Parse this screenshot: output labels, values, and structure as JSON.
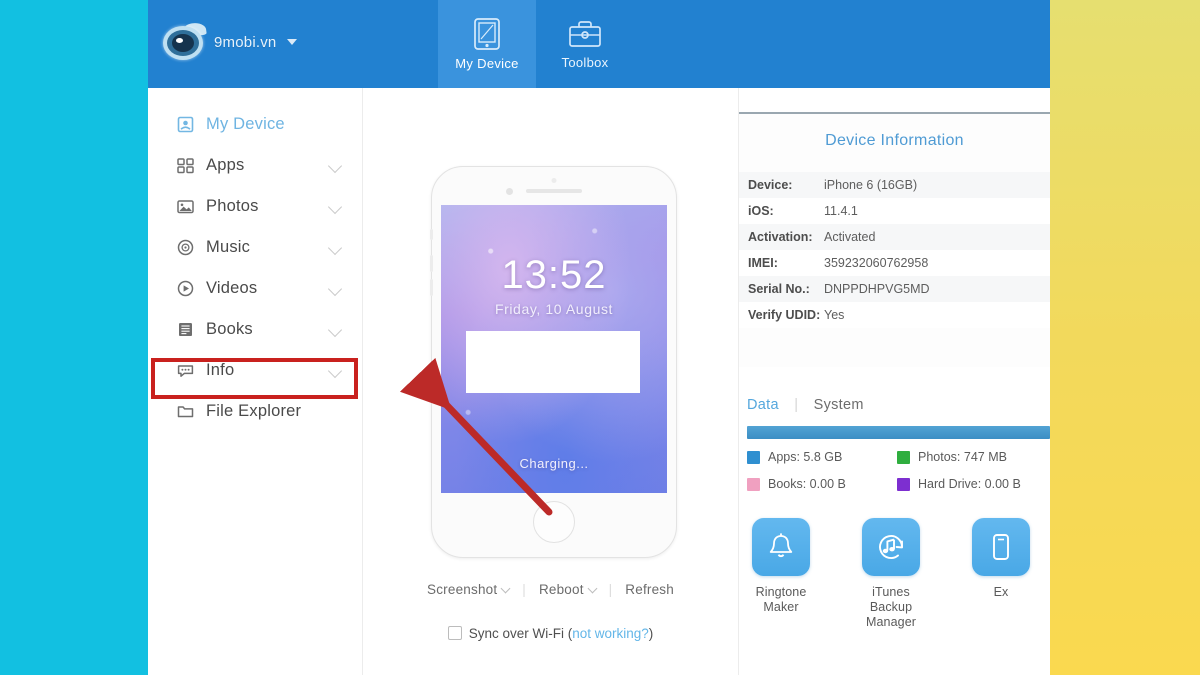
{
  "window": {
    "brand_name": "9mobi.vn",
    "logo_icon": "eye-logo-icon",
    "brand_caret_icon": "caret-down-icon"
  },
  "topbar": {
    "tabs": [
      {
        "label": "My Device",
        "icon": "tablet-icon",
        "active": true
      },
      {
        "label": "Toolbox",
        "icon": "toolbox-icon",
        "active": false
      }
    ]
  },
  "sidebar": {
    "items": [
      {
        "label": "My Device",
        "icon": "device-icon",
        "active": true,
        "expandable": false
      },
      {
        "label": "Apps",
        "icon": "grid-apps-icon",
        "active": false,
        "expandable": true
      },
      {
        "label": "Photos",
        "icon": "photo-icon",
        "active": false,
        "expandable": true
      },
      {
        "label": "Music",
        "icon": "music-disc-icon",
        "active": false,
        "expandable": true
      },
      {
        "label": "Videos",
        "icon": "video-play-icon",
        "active": false,
        "expandable": true
      },
      {
        "label": "Books",
        "icon": "books-icon",
        "active": false,
        "expandable": true
      },
      {
        "label": "Info",
        "icon": "chat-info-icon",
        "active": false,
        "expandable": true
      },
      {
        "label": "File Explorer",
        "icon": "folder-icon",
        "active": false,
        "expandable": false
      }
    ]
  },
  "annotation": {
    "highlight_color": "#c9211e",
    "highlight_target": "Info",
    "arrow_color": "#bc2a28"
  },
  "phone": {
    "lock_time": "13:52",
    "lock_date": "Friday, 10 August",
    "status": "Charging..."
  },
  "device_actions": {
    "screenshot": "Screenshot",
    "reboot": "Reboot",
    "refresh": "Refresh",
    "separator": "|",
    "chevron_icon": "chevron-down-icon"
  },
  "sync": {
    "checkbox_icon": "checkbox-unchecked-icon",
    "label": "Sync over Wi-Fi",
    "paren_open": "(",
    "link": "not working?",
    "paren_close": ")",
    "checked": false
  },
  "device_information": {
    "title": "Device Information",
    "rows": [
      {
        "key": "Device:",
        "value": "iPhone 6  (16GB)"
      },
      {
        "key": "iOS:",
        "value": "11.4.1"
      },
      {
        "key": "Activation:",
        "value": "Activated"
      },
      {
        "key": "IMEI:",
        "value": "359232060762958"
      },
      {
        "key": "Serial No.:",
        "value": "DNPPDHPVG5MD"
      },
      {
        "key": "Verify UDID:",
        "value": "Yes"
      }
    ]
  },
  "storage": {
    "tabs": [
      {
        "label": "Data",
        "active": true
      },
      {
        "label": "System",
        "active": false
      }
    ],
    "tab_separator": "|",
    "bar_fill_percent": 100,
    "bar_color": "#3b8ec4",
    "legend": [
      {
        "label": "Apps: 5.8 GB",
        "color": "#2f8fd0"
      },
      {
        "label": "Photos: 747 MB",
        "color": "#2fae3f"
      },
      {
        "label": "Books: 0.00 B",
        "color": "#f0a0c0"
      },
      {
        "label": "Hard Drive: 0.00 B",
        "color": "#7d2fd0"
      }
    ]
  },
  "tools": [
    {
      "label": "Ringtone\nMaker",
      "line1": "Ringtone",
      "line2": "Maker",
      "icon": "bell-icon"
    },
    {
      "label": "iTunes Backup\nManager",
      "line1": "iTunes Backup",
      "line2": "Manager",
      "icon": "music-refresh-icon"
    },
    {
      "label": "Ex",
      "line1": "Ex",
      "line2": "",
      "icon": "export-icon"
    }
  ],
  "decor": {
    "band_left_color": "#12c0e1",
    "band_right_color": "#f2d95c"
  }
}
